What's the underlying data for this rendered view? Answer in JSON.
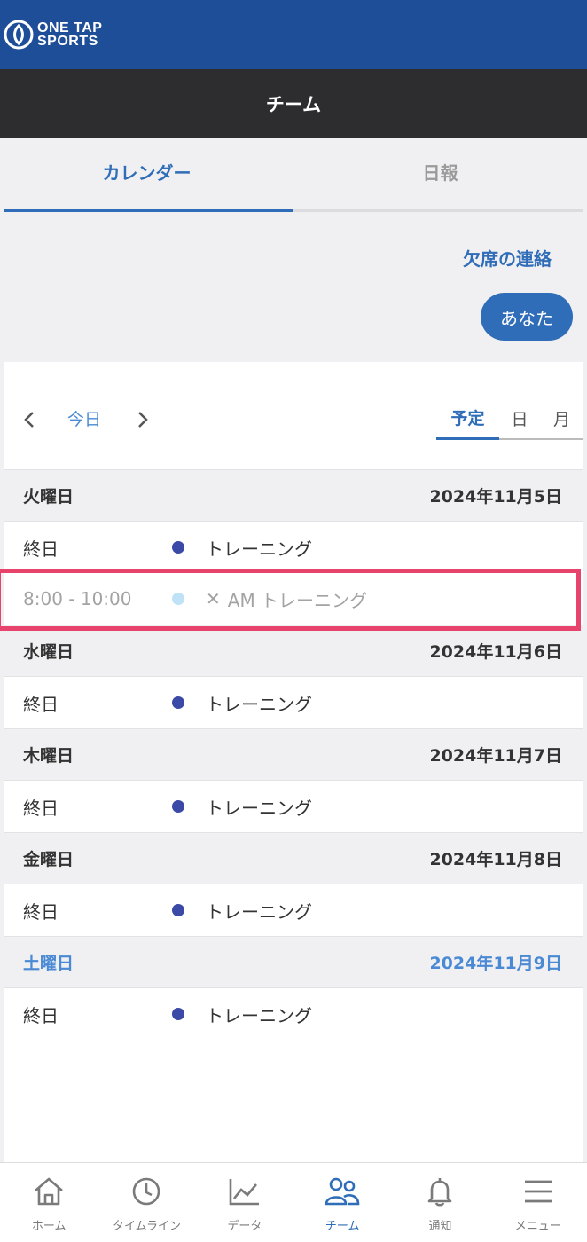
{
  "app": {
    "logo_line1": "ONE TAP",
    "logo_line2": "SPORTS",
    "page_title": "チーム"
  },
  "tabs": [
    {
      "label": "カレンダー",
      "active": true
    },
    {
      "label": "日報",
      "active": false
    }
  ],
  "absence_link": "欠席の連絡",
  "you_button": "あなた",
  "calendar_nav": {
    "today_label": "今日",
    "views": [
      {
        "label": "予定",
        "active": true
      },
      {
        "label": "日",
        "active": false
      },
      {
        "label": "月",
        "active": false
      }
    ]
  },
  "days": [
    {
      "weekday": "火曜日",
      "date": "2024年11月5日",
      "saturday": false,
      "events": [
        {
          "time": "終日",
          "title": "トレーニング",
          "cancelled": false,
          "prefix": ""
        },
        {
          "time": "8:00 - 10:00",
          "title": "AM トレーニング",
          "cancelled": true,
          "prefix": "✕"
        }
      ]
    },
    {
      "weekday": "水曜日",
      "date": "2024年11月6日",
      "saturday": false,
      "events": [
        {
          "time": "終日",
          "title": "トレーニング",
          "cancelled": false,
          "prefix": ""
        }
      ]
    },
    {
      "weekday": "木曜日",
      "date": "2024年11月7日",
      "saturday": false,
      "events": [
        {
          "time": "終日",
          "title": "トレーニング",
          "cancelled": false,
          "prefix": ""
        }
      ]
    },
    {
      "weekday": "金曜日",
      "date": "2024年11月8日",
      "saturday": false,
      "events": [
        {
          "time": "終日",
          "title": "トレーニング",
          "cancelled": false,
          "prefix": ""
        }
      ]
    },
    {
      "weekday": "土曜日",
      "date": "2024年11月9日",
      "saturday": true,
      "events": [
        {
          "time": "終日",
          "title": "トレーニング",
          "cancelled": false,
          "prefix": ""
        }
      ]
    }
  ],
  "colors": {
    "brand": "#1f4e98",
    "accent": "#2f6db8",
    "event_dot": "#3b4aa6",
    "cancelled_dot": "#bfe2f6",
    "highlight": "#e8436d"
  },
  "bottom_nav": [
    {
      "label": "ホーム",
      "icon": "home-icon",
      "active": false
    },
    {
      "label": "タイムライン",
      "icon": "clock-icon",
      "active": false
    },
    {
      "label": "データ",
      "icon": "chart-icon",
      "active": false
    },
    {
      "label": "チーム",
      "icon": "team-icon",
      "active": true
    },
    {
      "label": "通知",
      "icon": "bell-icon",
      "active": false
    },
    {
      "label": "メニュー",
      "icon": "menu-icon",
      "active": false
    }
  ]
}
